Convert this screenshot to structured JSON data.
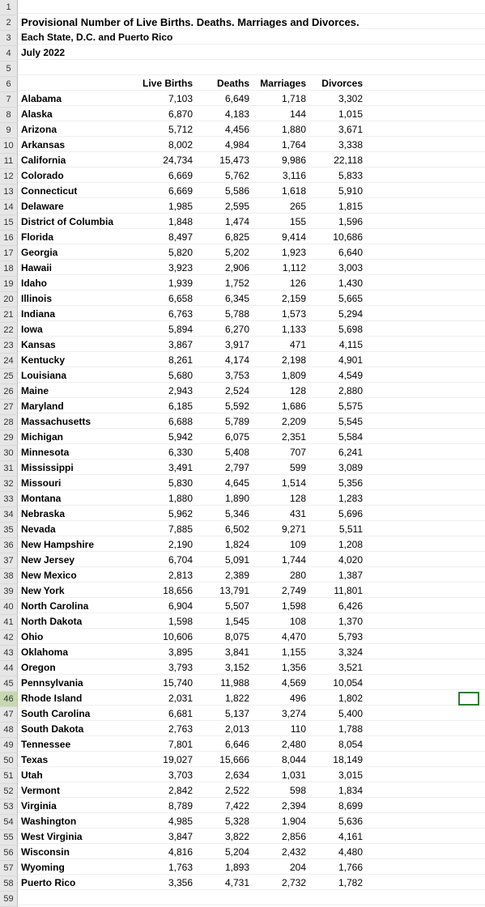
{
  "title": "Provisional Number of Live Births. Deaths. Marriages and Divorces.",
  "subtitle": "Each State, D.C. and Puerto Rico",
  "period": "July 2022",
  "columns": [
    "Live Births",
    "Deaths",
    "Marriages",
    "Divorces"
  ],
  "start_row_number": 1,
  "header_row_number": 6,
  "data_start_row_number": 7,
  "selected_row_number": 46,
  "rows": [
    {
      "state": "Alabama",
      "live_births": "7,103",
      "deaths": "6,649",
      "marriages": "1,718",
      "divorces": "3,302"
    },
    {
      "state": "Alaska",
      "live_births": "6,870",
      "deaths": "4,183",
      "marriages": "144",
      "divorces": "1,015"
    },
    {
      "state": "Arizona",
      "live_births": "5,712",
      "deaths": "4,456",
      "marriages": "1,880",
      "divorces": "3,671"
    },
    {
      "state": "Arkansas",
      "live_births": "8,002",
      "deaths": "4,984",
      "marriages": "1,764",
      "divorces": "3,338"
    },
    {
      "state": "California",
      "live_births": "24,734",
      "deaths": "15,473",
      "marriages": "9,986",
      "divorces": "22,118"
    },
    {
      "state": "Colorado",
      "live_births": "6,669",
      "deaths": "5,762",
      "marriages": "3,116",
      "divorces": "5,833"
    },
    {
      "state": "Connecticut",
      "live_births": "6,669",
      "deaths": "5,586",
      "marriages": "1,618",
      "divorces": "5,910"
    },
    {
      "state": "Delaware",
      "live_births": "1,985",
      "deaths": "2,595",
      "marriages": "265",
      "divorces": "1,815"
    },
    {
      "state": "District of Columbia",
      "live_births": "1,848",
      "deaths": "1,474",
      "marriages": "155",
      "divorces": "1,596"
    },
    {
      "state": "Florida",
      "live_births": "8,497",
      "deaths": "6,825",
      "marriages": "9,414",
      "divorces": "10,686"
    },
    {
      "state": "Georgia",
      "live_births": "5,820",
      "deaths": "5,202",
      "marriages": "1,923",
      "divorces": "6,640"
    },
    {
      "state": "Hawaii",
      "live_births": "3,923",
      "deaths": "2,906",
      "marriages": "1,112",
      "divorces": "3,003"
    },
    {
      "state": "Idaho",
      "live_births": "1,939",
      "deaths": "1,752",
      "marriages": "126",
      "divorces": "1,430"
    },
    {
      "state": "Illinois",
      "live_births": "6,658",
      "deaths": "6,345",
      "marriages": "2,159",
      "divorces": "5,665"
    },
    {
      "state": "Indiana",
      "live_births": "6,763",
      "deaths": "5,788",
      "marriages": "1,573",
      "divorces": "5,294"
    },
    {
      "state": "Iowa",
      "live_births": "5,894",
      "deaths": "6,270",
      "marriages": "1,133",
      "divorces": "5,698"
    },
    {
      "state": "Kansas",
      "live_births": "3,867",
      "deaths": "3,917",
      "marriages": "471",
      "divorces": "4,115"
    },
    {
      "state": "Kentucky",
      "live_births": "8,261",
      "deaths": "4,174",
      "marriages": "2,198",
      "divorces": "4,901"
    },
    {
      "state": "Louisiana",
      "live_births": "5,680",
      "deaths": "3,753",
      "marriages": "1,809",
      "divorces": "4,549"
    },
    {
      "state": "Maine",
      "live_births": "2,943",
      "deaths": "2,524",
      "marriages": "128",
      "divorces": "2,880"
    },
    {
      "state": "Maryland",
      "live_births": "6,185",
      "deaths": "5,592",
      "marriages": "1,686",
      "divorces": "5,575"
    },
    {
      "state": "Massachusetts",
      "live_births": "6,688",
      "deaths": "5,789",
      "marriages": "2,209",
      "divorces": "5,545"
    },
    {
      "state": "Michigan",
      "live_births": "5,942",
      "deaths": "6,075",
      "marriages": "2,351",
      "divorces": "5,584"
    },
    {
      "state": "Minnesota",
      "live_births": "6,330",
      "deaths": "5,408",
      "marriages": "707",
      "divorces": "6,241"
    },
    {
      "state": "Mississippi",
      "live_births": "3,491",
      "deaths": "2,797",
      "marriages": "599",
      "divorces": "3,089"
    },
    {
      "state": "Missouri",
      "live_births": "5,830",
      "deaths": "4,645",
      "marriages": "1,514",
      "divorces": "5,356"
    },
    {
      "state": "Montana",
      "live_births": "1,880",
      "deaths": "1,890",
      "marriages": "128",
      "divorces": "1,283"
    },
    {
      "state": "Nebraska",
      "live_births": "5,962",
      "deaths": "5,346",
      "marriages": "431",
      "divorces": "5,696"
    },
    {
      "state": "Nevada",
      "live_births": "7,885",
      "deaths": "6,502",
      "marriages": "9,271",
      "divorces": "5,511"
    },
    {
      "state": "New Hampshire",
      "live_births": "2,190",
      "deaths": "1,824",
      "marriages": "109",
      "divorces": "1,208"
    },
    {
      "state": "New Jersey",
      "live_births": "6,704",
      "deaths": "5,091",
      "marriages": "1,744",
      "divorces": "4,020"
    },
    {
      "state": "New Mexico",
      "live_births": "2,813",
      "deaths": "2,389",
      "marriages": "280",
      "divorces": "1,387"
    },
    {
      "state": "New York",
      "live_births": "18,656",
      "deaths": "13,791",
      "marriages": "2,749",
      "divorces": "11,801"
    },
    {
      "state": "North Carolina",
      "live_births": "6,904",
      "deaths": "5,507",
      "marriages": "1,598",
      "divorces": "6,426"
    },
    {
      "state": "North Dakota",
      "live_births": "1,598",
      "deaths": "1,545",
      "marriages": "108",
      "divorces": "1,370"
    },
    {
      "state": "Ohio",
      "live_births": "10,606",
      "deaths": "8,075",
      "marriages": "4,470",
      "divorces": "5,793"
    },
    {
      "state": "Oklahoma",
      "live_births": "3,895",
      "deaths": "3,841",
      "marriages": "1,155",
      "divorces": "3,324"
    },
    {
      "state": "Oregon",
      "live_births": "3,793",
      "deaths": "3,152",
      "marriages": "1,356",
      "divorces": "3,521"
    },
    {
      "state": "Pennsylvania",
      "live_births": "15,740",
      "deaths": "11,988",
      "marriages": "4,569",
      "divorces": "10,054"
    },
    {
      "state": "Rhode Island",
      "live_births": "2,031",
      "deaths": "1,822",
      "marriages": "496",
      "divorces": "1,802"
    },
    {
      "state": "South Carolina",
      "live_births": "6,681",
      "deaths": "5,137",
      "marriages": "3,274",
      "divorces": "5,400"
    },
    {
      "state": "South Dakota",
      "live_births": "2,763",
      "deaths": "2,013",
      "marriages": "110",
      "divorces": "1,788"
    },
    {
      "state": "Tennessee",
      "live_births": "7,801",
      "deaths": "6,646",
      "marriages": "2,480",
      "divorces": "8,054"
    },
    {
      "state": "Texas",
      "live_births": "19,027",
      "deaths": "15,666",
      "marriages": "8,044",
      "divorces": "18,149"
    },
    {
      "state": "Utah",
      "live_births": "3,703",
      "deaths": "2,634",
      "marriages": "1,031",
      "divorces": "3,015"
    },
    {
      "state": "Vermont",
      "live_births": "2,842",
      "deaths": "2,522",
      "marriages": "598",
      "divorces": "1,834"
    },
    {
      "state": "Virginia",
      "live_births": "8,789",
      "deaths": "7,422",
      "marriages": "2,394",
      "divorces": "8,699"
    },
    {
      "state": "Washington",
      "live_births": "4,985",
      "deaths": "5,328",
      "marriages": "1,904",
      "divorces": "5,636"
    },
    {
      "state": "West Virginia",
      "live_births": "3,847",
      "deaths": "3,822",
      "marriages": "2,856",
      "divorces": "4,161"
    },
    {
      "state": "Wisconsin",
      "live_births": "4,816",
      "deaths": "5,204",
      "marriages": "2,432",
      "divorces": "4,480"
    },
    {
      "state": "Wyoming",
      "live_births": "1,763",
      "deaths": "1,893",
      "marriages": "204",
      "divorces": "1,766"
    },
    {
      "state": "Puerto Rico",
      "live_births": "3,356",
      "deaths": "4,731",
      "marriages": "2,732",
      "divorces": "1,782"
    }
  ]
}
